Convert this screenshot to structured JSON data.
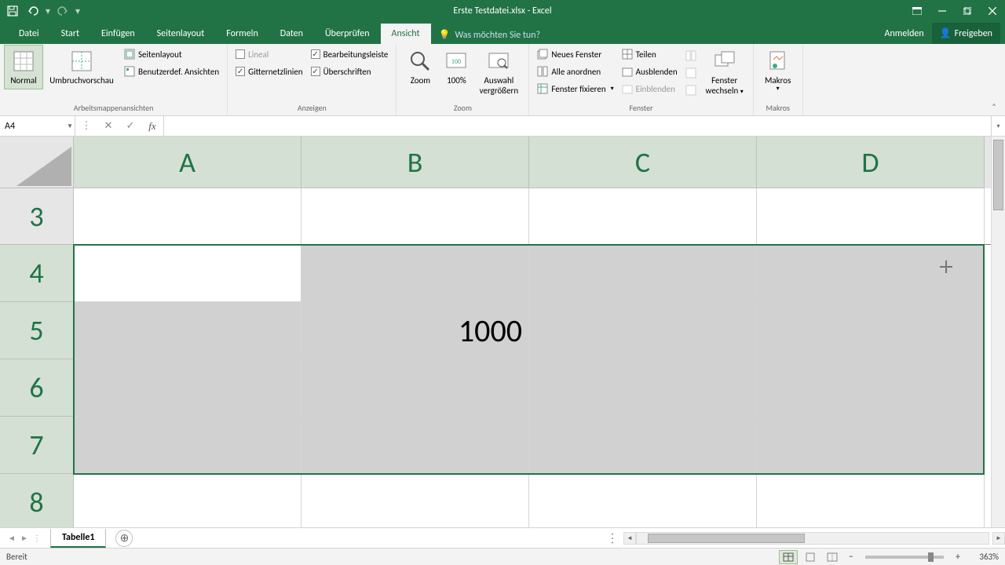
{
  "titlebar": {
    "title": "Erste Testdatei.xlsx - Excel"
  },
  "tabs": {
    "file": "Datei",
    "home": "Start",
    "insert": "Einfügen",
    "pagelayout": "Seitenlayout",
    "formulas": "Formeln",
    "data": "Daten",
    "review": "Überprüfen",
    "view": "Ansicht",
    "tellme": "Was möchten Sie tun?",
    "signin": "Anmelden",
    "share": "Freigeben"
  },
  "ribbon": {
    "views": {
      "normal": "Normal",
      "pagebreak": "Umbruchvorschau",
      "pagelayout": "Seitenlayout",
      "custom": "Benutzerdef. Ansichten",
      "group": "Arbeitsmappenansichten"
    },
    "show": {
      "ruler": "Lineal",
      "formulabar": "Bearbeitungsleiste",
      "gridlines": "Gitternetzlinien",
      "headings": "Überschriften",
      "group": "Anzeigen"
    },
    "zoom": {
      "zoom": "Zoom",
      "hundred": "100%",
      "selection_l1": "Auswahl",
      "selection_l2": "vergrößern",
      "group": "Zoom"
    },
    "window": {
      "new": "Neues Fenster",
      "arrange": "Alle anordnen",
      "freeze": "Fenster fixieren",
      "split": "Teilen",
      "hide": "Ausblenden",
      "unhide": "Einblenden",
      "switch_l1": "Fenster",
      "switch_l2": "wechseln",
      "group": "Fenster"
    },
    "macros": {
      "macros": "Makros",
      "group": "Makros"
    }
  },
  "namebox": "A4",
  "formula": "",
  "columns": [
    "A",
    "B",
    "C",
    "D"
  ],
  "rows": [
    "3",
    "4",
    "5",
    "6",
    "7",
    "8"
  ],
  "cells": {
    "B5": "1000"
  },
  "sheet": {
    "tab1": "Tabelle1"
  },
  "status": {
    "ready": "Bereit",
    "zoom": "363%"
  }
}
